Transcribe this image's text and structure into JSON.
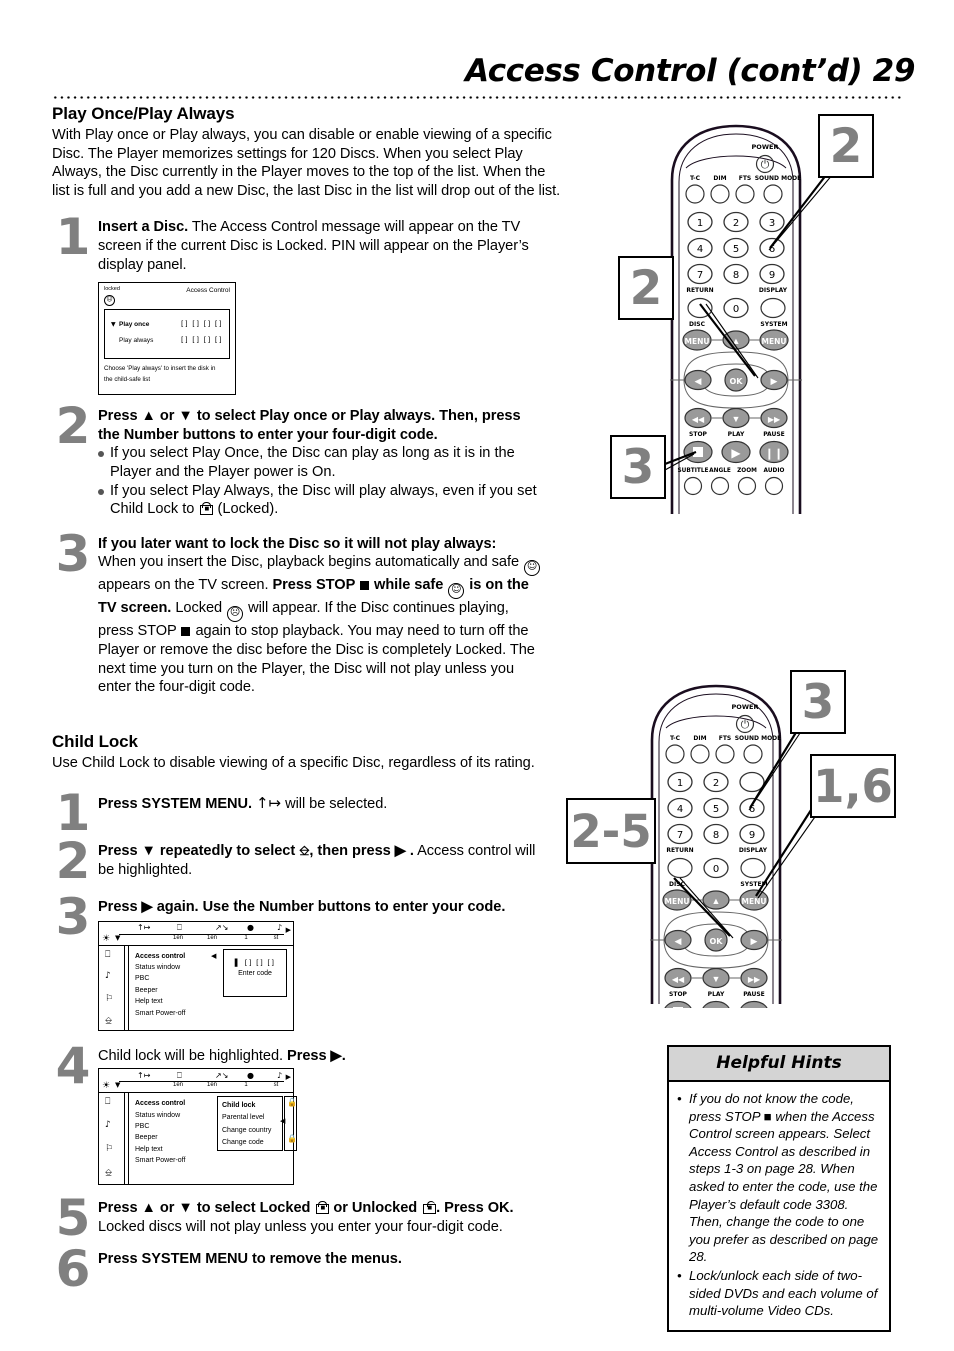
{
  "header": {
    "title": "Access Control (cont’d)  29"
  },
  "section1": {
    "heading": "Play Once/Play Always",
    "intro": "With Play once or Play always, you can disable or enable viewing of a specific Disc. The Player memorizes settings for 120 Discs. When you select Play Always, the Disc currently in the Player moves to the top of the list. When the list is full and you add a new Disc, the last Disc in the list will drop out of the list.",
    "steps": [
      {
        "num": "1",
        "bold": "Insert a Disc.",
        "rest": " The Access Control message will appear on the TV screen if the current Disc is Locked. PIN will appear on the Player’s display panel."
      },
      {
        "num": "2",
        "bold": "Press ▲ or ▼ to select Play once or Play always. Then, press the Number buttons to enter your four-digit code.",
        "bullet1": "If you select Play Once, the Disc can play as long as it is in the Player and the Player power is On.",
        "bullet2_a": "If you select Play Always, the Disc will play always, even if you set Child Lock to ",
        "bullet2_b": " (Locked)."
      },
      {
        "num": "3",
        "bold": "If you later want to lock the Disc so it will not play always:",
        "t1": "When you insert the Disc, playback begins automatically and safe ",
        "t2": " appears on the TV screen. ",
        "b2": "Press STOP ",
        "b3": " while safe ",
        "b4": " is on the TV screen.",
        "t3": " Locked ",
        "t4": " will appear. If the Disc continues playing, press STOP ",
        "t5": " again to stop playback. You may need to turn off the Player or remove the disc before the Disc is completely Locked. The next time you turn on the Player, the Disc will not play unless you enter the four-digit code."
      }
    ]
  },
  "tv_screen": {
    "locked_label": "locked",
    "title": "Access Control",
    "rows": [
      {
        "name": "Play once",
        "boxes": "[] [] [] []",
        "selected": true
      },
      {
        "name": "Play always",
        "boxes": "[] [] [] []",
        "selected": false
      }
    ],
    "footer_line1": "Choose 'Play always' to insert the disk in",
    "footer_line2": "the child-safe list"
  },
  "section2": {
    "heading": "Child Lock",
    "intro": "Use Child Lock to disable viewing of a specific Disc, regardless of its rating.",
    "steps": [
      {
        "num": "1",
        "bold": "Press SYSTEM MENU.",
        "rest": " will be selected."
      },
      {
        "num": "2",
        "bold_a": "Press ▼ repeatedly to select ",
        "bold_b": ", then press ▶ .",
        "rest": " Access control will be highlighted."
      },
      {
        "num": "3",
        "bold": "Press ▶ again. Use the Number buttons to enter your code."
      },
      {
        "num": "4",
        "plain": "Child lock will be highlighted. ",
        "bold": "Press ▶."
      },
      {
        "num": "5",
        "bold_a": "Press ▲ or ▼ to select Locked ",
        "bold_b": " or Unlocked ",
        "bold_c": ". Press OK.",
        "rest": "Locked discs will not play unless you enter your four-digit code."
      },
      {
        "num": "6",
        "bold": "Press SYSTEM MENU to remove the menus."
      }
    ]
  },
  "osd_menu": {
    "topbar_labels": [
      "1en",
      "1en",
      "1",
      "st"
    ],
    "sidebar_icons": [
      "picture-icon",
      "sound-icon",
      "language-icon",
      "features-icon"
    ],
    "items": [
      "Access control",
      "Status window",
      "PBC",
      "Beeper",
      "Help text",
      "Smart Power-off"
    ],
    "selected_item": "Access control",
    "code_panel": {
      "code": "[] [] []",
      "label": "Enter code"
    },
    "submenu": {
      "items": [
        "Child lock",
        "Parental level",
        "Change country",
        "Change code"
      ],
      "selected_item": "Child lock"
    }
  },
  "hints": {
    "title": "Helpful Hints",
    "items": [
      "If you do not know the code, press STOP ■ when the Access Control screen appears. Select Access Control as described in steps 1-3 on page 28. When asked to enter the code, use the Player’s default code 3308. Then, change the code to one you prefer as described on page 28.",
      "Lock/unlock each side of two-sided DVDs and each volume of multi-volume Video CDs."
    ]
  },
  "remote1": {
    "power_label": "POWER",
    "top_buttons": [
      "T-C",
      "DIM",
      "FTS",
      "SOUND MODE"
    ],
    "numbers": [
      "1",
      "2",
      "3",
      "4",
      "5",
      "6",
      "7",
      "8",
      "9",
      "0"
    ],
    "return_label": "RETURN",
    "display_label": "DISPLAY",
    "disc_label": "DISC",
    "system_label": "SYSTEM",
    "menu_label": "MENU",
    "ok_label": "OK",
    "transport_labels": [
      "STOP",
      "PLAY",
      "PAUSE"
    ],
    "bottom_buttons": [
      "SUBTITLE",
      "ANGLE",
      "ZOOM",
      "AUDIO"
    ],
    "callouts": [
      {
        "text": "2",
        "target": "number-6-button"
      },
      {
        "text": "2",
        "target": "ok-button"
      },
      {
        "text": "3",
        "target": "stop-button"
      }
    ]
  },
  "remote2": {
    "power_label": "POWER",
    "top_buttons": [
      "T-C",
      "DIM",
      "FTS",
      "SOUND MODE"
    ],
    "numbers": [
      "1",
      "2",
      "3",
      "4",
      "5",
      "6",
      "7",
      "8",
      "9",
      "0"
    ],
    "return_label": "RETURN",
    "display_label": "DISPLAY",
    "disc_label": "DISC",
    "system_label": "SYSTEM",
    "menu_label": "MENU",
    "ok_label": "OK",
    "transport_labels": [
      "STOP",
      "PLAY",
      "PAUSE"
    ],
    "callouts": [
      {
        "text": "3",
        "target": "number-6-button"
      },
      {
        "text": "1,6",
        "target": "system-menu-button"
      },
      {
        "text": "2-5",
        "target": "ok-button"
      }
    ]
  },
  "colors": {
    "callout_number": "#808080",
    "hints_header_bg": "#d4d4d4",
    "button_fill": "#9a9a9a"
  }
}
